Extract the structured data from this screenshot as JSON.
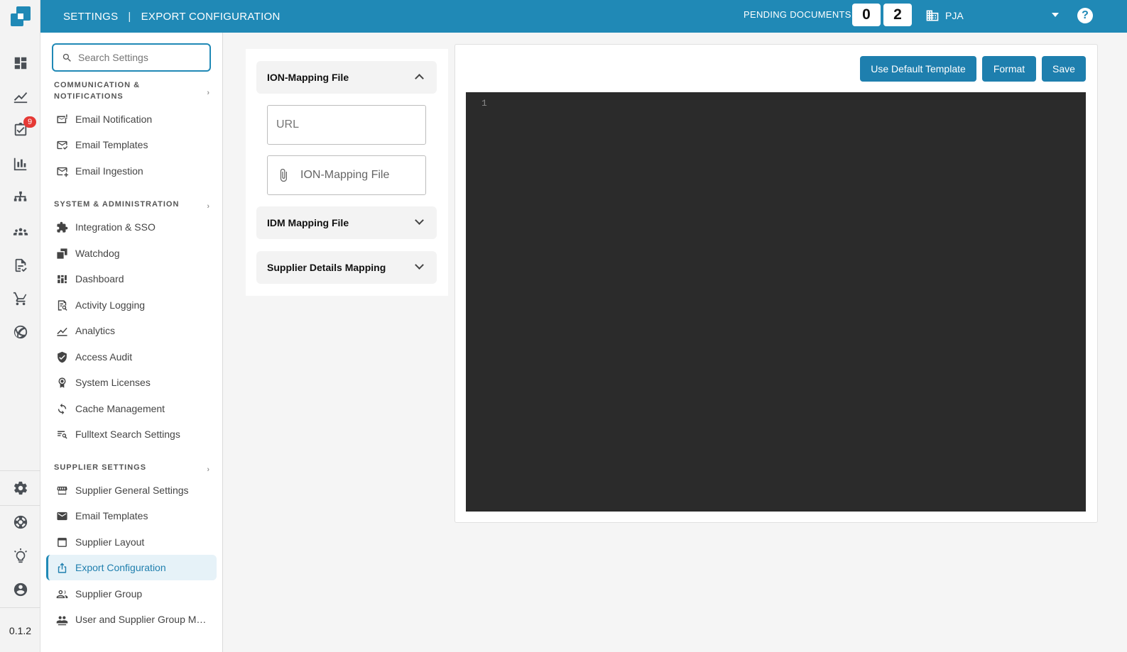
{
  "header": {
    "breadcrumb": [
      "SETTINGS",
      "EXPORT CONFIGURATION"
    ],
    "pending_label": "PENDING DOCUMENTS:",
    "pending_digits": [
      "0",
      "2"
    ],
    "organization": "PJA",
    "help_label": "?"
  },
  "rail": {
    "badge_count": "9",
    "version": "0.1.2"
  },
  "sidebar": {
    "search_placeholder": "Search Settings",
    "sections": [
      {
        "title_line1": "COMMUNICATION &",
        "title_line2": "NOTIFICATIONS",
        "items": [
          "Email Notification",
          "Email Templates",
          "Email Ingestion"
        ]
      },
      {
        "title": "SYSTEM & ADMINISTRATION",
        "items": [
          "Integration & SSO",
          "Watchdog",
          "Dashboard",
          "Activity Logging",
          "Analytics",
          "Access Audit",
          "System Licenses",
          "Cache Management",
          "Fulltext Search Settings"
        ]
      },
      {
        "title": "SUPPLIER SETTINGS",
        "items": [
          "Supplier General Settings",
          "Email Templates",
          "Supplier Layout",
          "Export Configuration",
          "Supplier Group",
          "User and Supplier Group Ma..."
        ]
      }
    ]
  },
  "accordion": {
    "sections": [
      {
        "title": "ION-Mapping File",
        "expanded": true
      },
      {
        "title": "IDM Mapping File",
        "expanded": false
      },
      {
        "title": "Supplier Details Mapping",
        "expanded": false
      }
    ],
    "url_placeholder": "URL",
    "file_placeholder": "ION-Mapping File"
  },
  "editor": {
    "buttons": {
      "default_template": "Use Default Template",
      "format": "Format",
      "save": "Save"
    },
    "line_numbers": [
      "1"
    ],
    "background_color": "#2b2b2b"
  },
  "colors": {
    "brand": "#2089b6",
    "badge": "#e53935"
  }
}
